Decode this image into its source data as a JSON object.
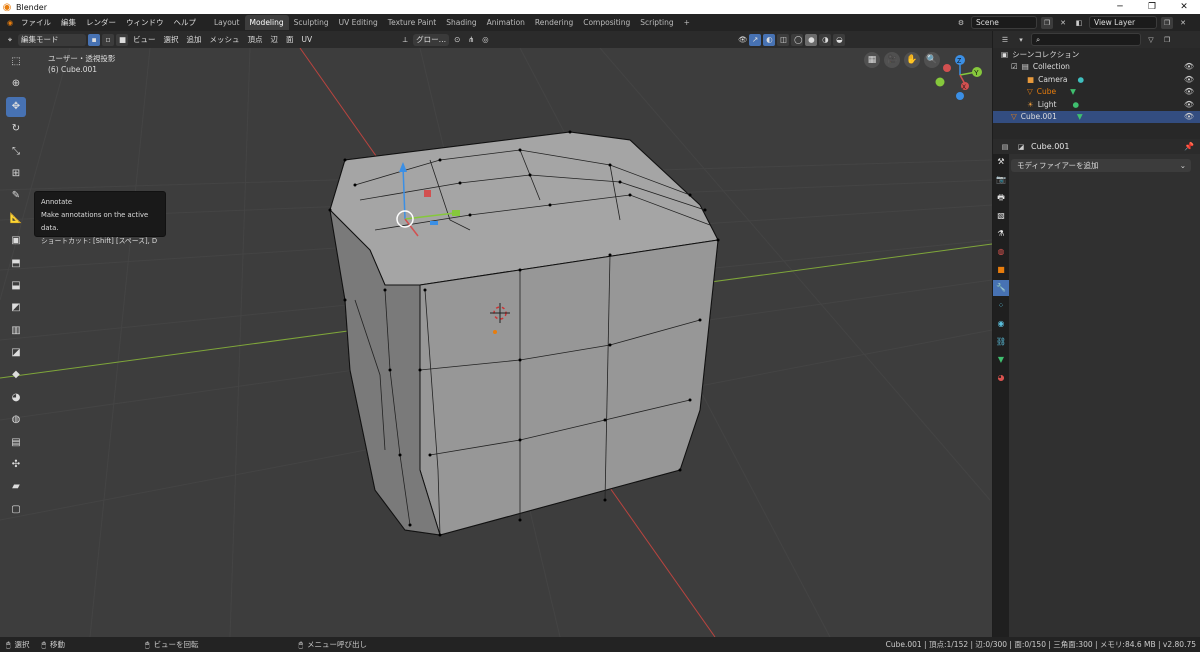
{
  "window": {
    "title": "Blender",
    "minimize": "─",
    "maximize": "❐",
    "close": "✕"
  },
  "menu": [
    "ファイル",
    "編集",
    "レンダー",
    "ウィンドウ",
    "ヘルプ"
  ],
  "workspaces": [
    "Layout",
    "Modeling",
    "Sculpting",
    "UV Editing",
    "Texture Paint",
    "Shading",
    "Animation",
    "Rendering",
    "Compositing",
    "Scripting",
    "+"
  ],
  "active_workspace": "Modeling",
  "scene": {
    "name": "Scene",
    "view_layer": "View Layer"
  },
  "header": {
    "mode": "編集モード",
    "menus": [
      "ビュー",
      "選択",
      "追加",
      "メッシュ",
      "頂点",
      "辺",
      "面",
      "UV"
    ],
    "transform_orientation": "グロー…"
  },
  "viewport": {
    "view_label": "ユーザー・透視投影",
    "object_label": "(6) Cube.001"
  },
  "tooltip": {
    "title": "Annotate",
    "description": "Make annotations on the active data.",
    "shortcut": "ショートカット: [Shift] [スペース], D"
  },
  "outliner": {
    "root": "シーンコレクション",
    "items": [
      {
        "label": "Collection",
        "icon": "collection-icon"
      },
      {
        "label": "Camera",
        "icon": "camera-icon"
      },
      {
        "label": "Cube",
        "icon": "mesh-icon"
      },
      {
        "label": "Light",
        "icon": "light-icon"
      },
      {
        "label": "Cube.001",
        "icon": "mesh-icon"
      }
    ]
  },
  "properties": {
    "object_name": "Cube.001",
    "add_modifier": "モディファイアーを追加"
  },
  "statusbar": {
    "select": "選択",
    "move": "移動",
    "rotate_view": "ビューを回転",
    "context_menu": "メニュー呼び出し",
    "stats": "Cube.001 | 頂点:1/152 | 辺:0/300 | 面:0/150 | 三角面:300 | メモリ:84.6 MB | v2.80.75"
  },
  "colors": {
    "accent": "#4772b3",
    "axis_x": "#c0504a",
    "axis_y": "#8cb43a",
    "object_orange": "#e87d0d"
  },
  "gizmo_axes": [
    "X",
    "Y",
    "Z"
  ]
}
